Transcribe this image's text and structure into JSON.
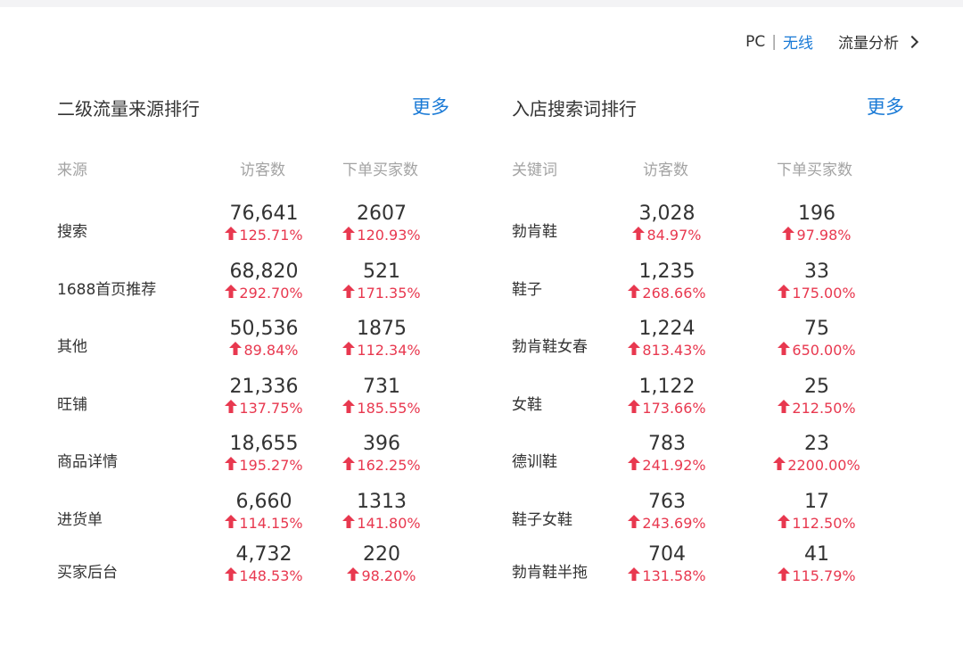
{
  "topbar": {
    "pc": "PC",
    "sep": "|",
    "wireless": "无线",
    "analysis": "流量分析"
  },
  "left": {
    "title": "二级流量来源排行",
    "more": "更多",
    "headers": [
      "来源",
      "访客数",
      "下单买家数"
    ],
    "rows": [
      {
        "name": "搜索",
        "visitors": "76,641",
        "visitors_pct": "125.71%",
        "buyers": "2607",
        "buyers_pct": "120.93%"
      },
      {
        "name": "1688首页推荐",
        "visitors": "68,820",
        "visitors_pct": "292.70%",
        "buyers": "521",
        "buyers_pct": "171.35%"
      },
      {
        "name": "其他",
        "visitors": "50,536",
        "visitors_pct": "89.84%",
        "buyers": "1875",
        "buyers_pct": "112.34%"
      },
      {
        "name": "旺铺",
        "visitors": "21,336",
        "visitors_pct": "137.75%",
        "buyers": "731",
        "buyers_pct": "185.55%"
      },
      {
        "name": "商品详情",
        "visitors": "18,655",
        "visitors_pct": "195.27%",
        "buyers": "396",
        "buyers_pct": "162.25%"
      },
      {
        "name": "进货单",
        "visitors": "6,660",
        "visitors_pct": "114.15%",
        "buyers": "1313",
        "buyers_pct": "141.80%"
      },
      {
        "name": "买家后台",
        "visitors": "4,732",
        "visitors_pct": "148.53%",
        "buyers": "220",
        "buyers_pct": "98.20%"
      }
    ]
  },
  "right": {
    "title": "入店搜索词排行",
    "more": "更多",
    "headers": [
      "关键词",
      "访客数",
      "下单买家数"
    ],
    "rows": [
      {
        "name": "勃肯鞋",
        "visitors": "3,028",
        "visitors_pct": "84.97%",
        "buyers": "196",
        "buyers_pct": "97.98%"
      },
      {
        "name": "鞋子",
        "visitors": "1,235",
        "visitors_pct": "268.66%",
        "buyers": "33",
        "buyers_pct": "175.00%"
      },
      {
        "name": "勃肯鞋女春",
        "visitors": "1,224",
        "visitors_pct": "813.43%",
        "buyers": "75",
        "buyers_pct": "650.00%"
      },
      {
        "name": "女鞋",
        "visitors": "1,122",
        "visitors_pct": "173.66%",
        "buyers": "25",
        "buyers_pct": "212.50%"
      },
      {
        "name": "德训鞋",
        "visitors": "783",
        "visitors_pct": "241.92%",
        "buyers": "23",
        "buyers_pct": "2200.00%"
      },
      {
        "name": "鞋子女鞋",
        "visitors": "763",
        "visitors_pct": "243.69%",
        "buyers": "17",
        "buyers_pct": "112.50%"
      },
      {
        "name": "勃肯鞋半拖",
        "visitors": "704",
        "visitors_pct": "131.58%",
        "buyers": "41",
        "buyers_pct": "115.79%"
      }
    ]
  },
  "colors": {
    "accent": "#1a7ad6",
    "up": "#e8384f",
    "header": "#a3a3a3",
    "text": "#333333"
  },
  "icons": {
    "trend": "arrow-up-icon",
    "nav": "chevron-right-icon"
  }
}
